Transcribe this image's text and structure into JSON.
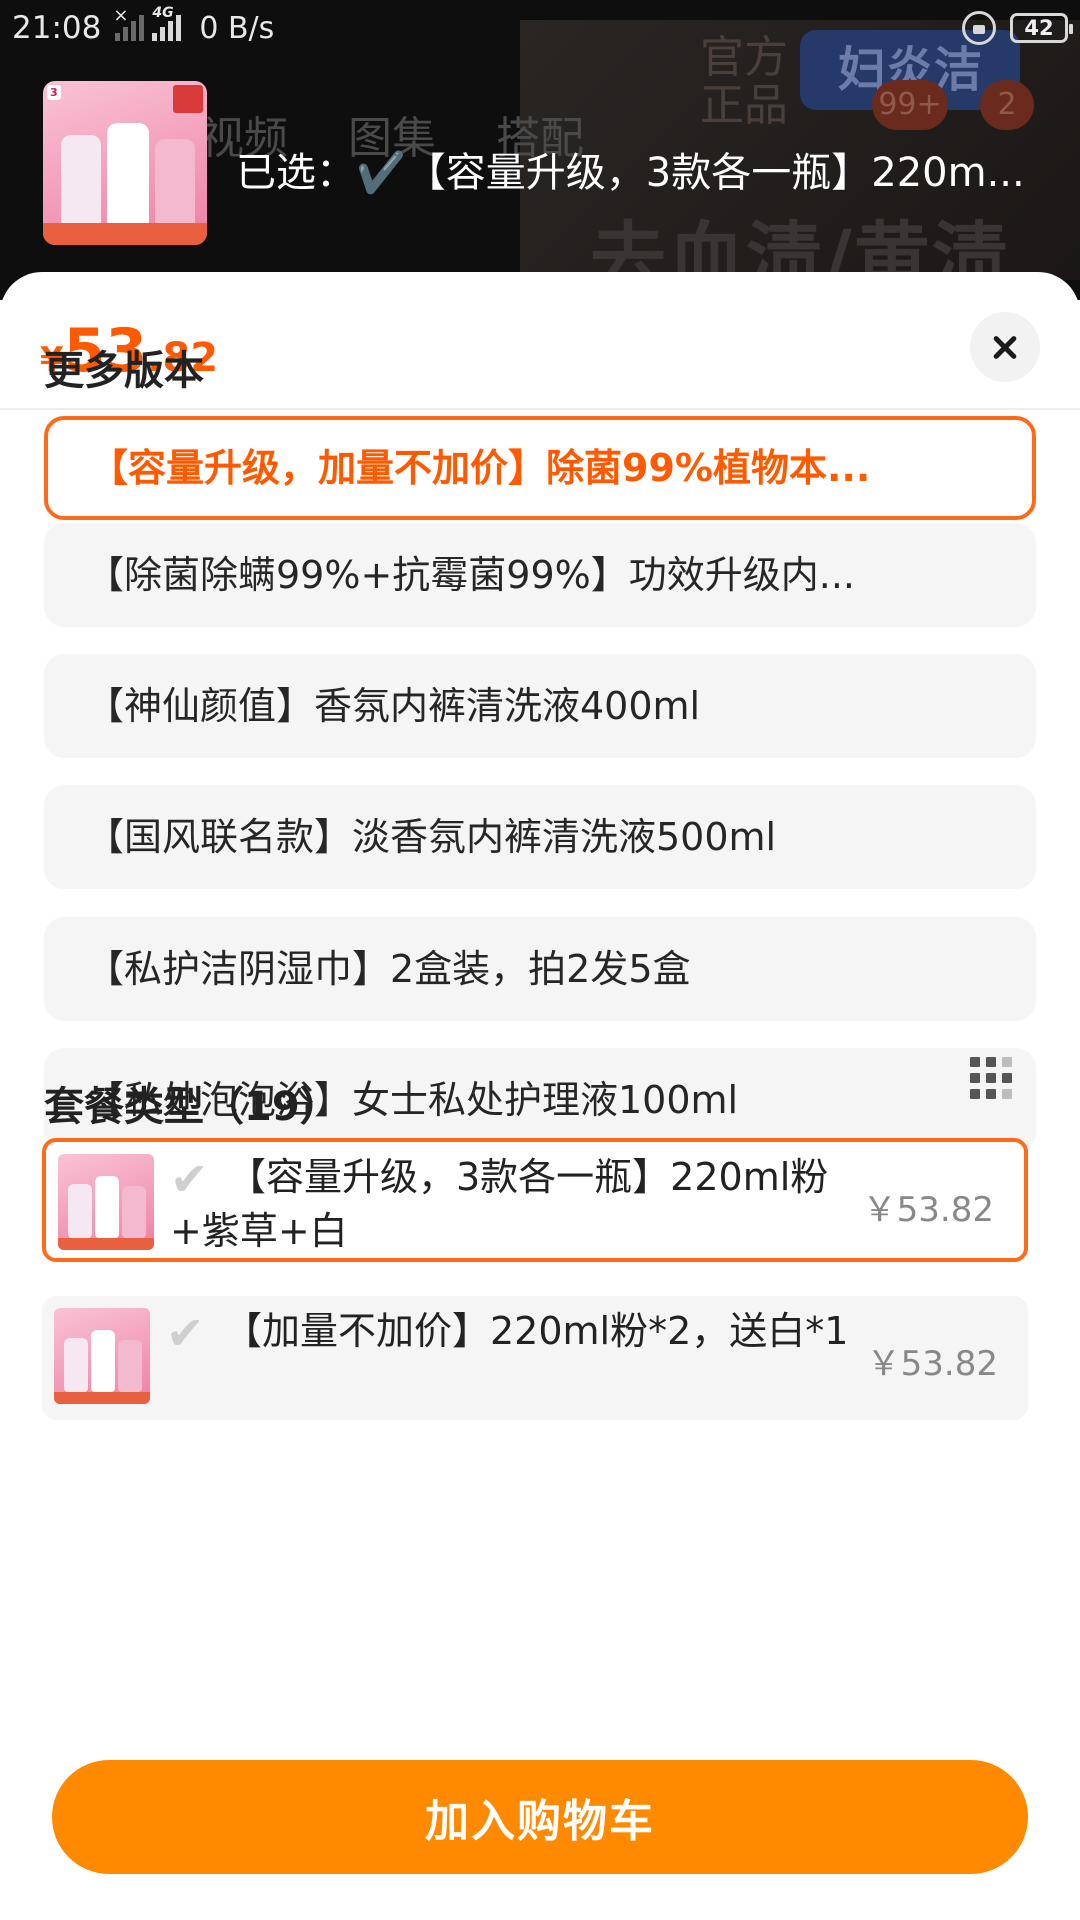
{
  "status_bar": {
    "time": "21:08",
    "network_type": "4G",
    "net_speed": "0 B/s",
    "battery": "42"
  },
  "background": {
    "tabs": [
      "视频",
      "图集",
      "搭配"
    ],
    "official": "官方正品",
    "brand": "妇炎洁",
    "badge_left": "99+",
    "badge_right": "2",
    "slogan": "去血渍/黄渍"
  },
  "header": {
    "selected_label": "已选：✔️【容量升级，3款各一瓶】220m..."
  },
  "price": {
    "currency": "¥",
    "integer": "53",
    "decimal": ".82"
  },
  "versions": {
    "title": "更多版本",
    "items": [
      {
        "label": "【容量升级，加量不加价】除菌99%植物本...",
        "selected": true
      },
      {
        "label": "【除菌除螨99%+抗霉菌99%】功效升级内...",
        "selected": false
      },
      {
        "label": "【神仙颜值】香氛内裤清洗液400ml",
        "selected": false
      },
      {
        "label": "【国风联名款】淡香氛内裤清洗液500ml",
        "selected": false
      },
      {
        "label": "【私护洁阴湿巾】2盒装，拍2发5盒",
        "selected": false
      },
      {
        "label": "【私处泡泡浴】女士私处护理液100ml",
        "selected": false
      }
    ]
  },
  "packages": {
    "title": "套餐类型（19）",
    "items": [
      {
        "label": "【容量升级，3款各一瓶】220ml粉+紫草+白",
        "price": "￥53.82",
        "selected": true
      },
      {
        "label": "【加量不加价】220ml粉*2，送白*1",
        "price": "￥53.82",
        "selected": false
      }
    ]
  },
  "actions": {
    "add_to_cart": "加入购物车"
  },
  "colors": {
    "accent": "#ff5a00",
    "button": "#ff8a00",
    "option_bg": "#f5f5f5"
  }
}
